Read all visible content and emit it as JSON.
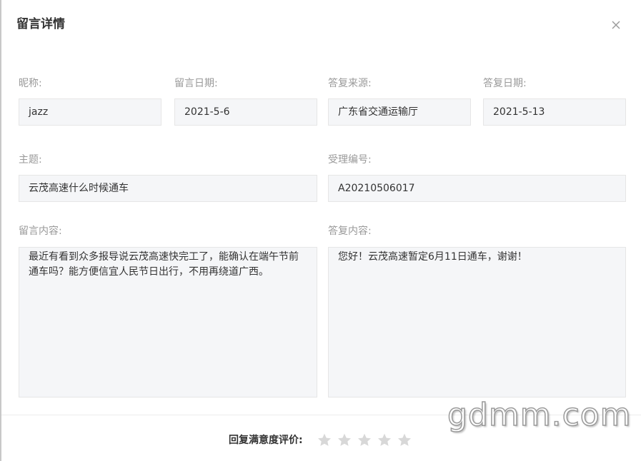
{
  "dialog": {
    "title": "留言详情",
    "close_icon": "close-icon"
  },
  "fields": {
    "nickname": {
      "label": "昵称:",
      "value": "jazz"
    },
    "message_date": {
      "label": "留言日期:",
      "value": "2021-5-6"
    },
    "reply_source": {
      "label": "答复来源:",
      "value": "广东省交通运输厅"
    },
    "reply_date": {
      "label": "答复日期:",
      "value": "2021-5-13"
    },
    "subject": {
      "label": "主题:",
      "value": "云茂高速什么时候通车"
    },
    "case_number": {
      "label": "受理编号:",
      "value": "A20210506017"
    },
    "message_content": {
      "label": "留言内容:",
      "value": "最近有看到众多报导说云茂高速快完工了，能确认在端午节前通车吗？能方便信宜人民节日出行，不用再绕道广西。"
    },
    "reply_content": {
      "label": "答复内容:",
      "value": "您好！云茂高速暂定6月11日通车，谢谢！"
    }
  },
  "rating": {
    "label": "回复满意度评价:",
    "stars_total": 5,
    "stars_selected": 0,
    "star_icon": "star-icon",
    "star_color": "#d8d8d8"
  },
  "watermark": {
    "text": "gdmm.com"
  }
}
